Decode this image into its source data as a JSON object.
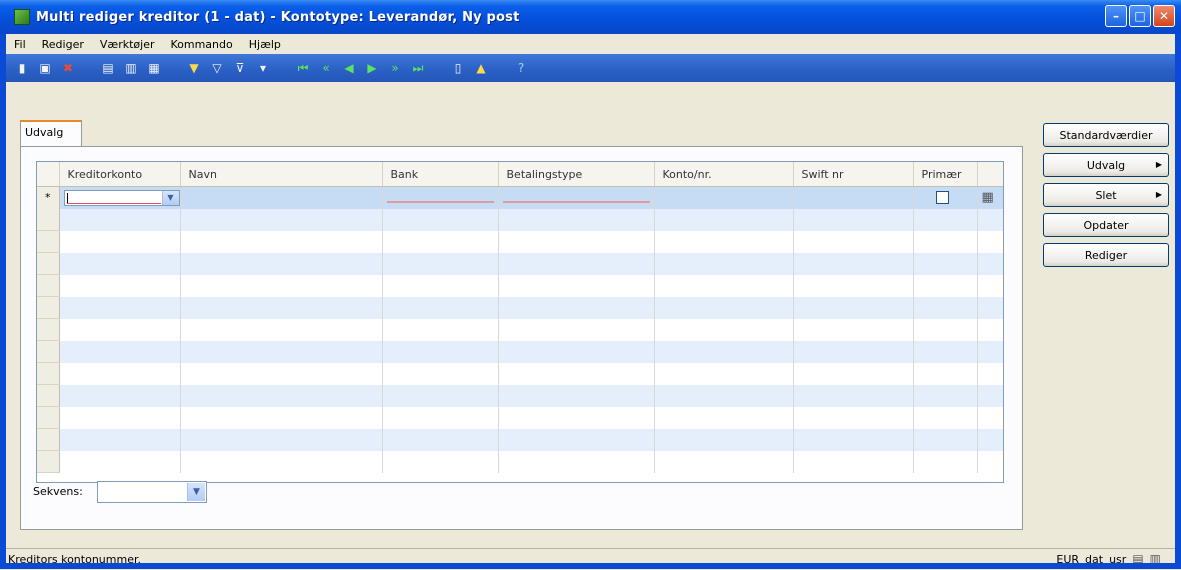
{
  "window": {
    "title": "Multi rediger kreditor (1 - dat) - Kontotype: Leverandør, Ny post"
  },
  "menu": [
    "Fil",
    "Rediger",
    "Værktøjer",
    "Kommando",
    "Hjælp"
  ],
  "tab": {
    "label": "Udvalg"
  },
  "grid": {
    "columns": [
      "Kreditorkonto",
      "Navn",
      "Bank",
      "Betalingstype",
      "Konto/nr.",
      "Swift nr",
      "Primær",
      ""
    ],
    "new_row_marker": "*"
  },
  "sequence": {
    "label": "Sekvens:",
    "value": ""
  },
  "buttons": {
    "defaults": "Standardværdier",
    "selection": "Udvalg",
    "delete": "Slet",
    "update": "Opdater",
    "edit": "Rediger"
  },
  "status": {
    "message": "Kreditors kontonummer.",
    "currency": "EUR",
    "company": "dat",
    "user": "usr"
  },
  "colors": {
    "title_bar": "#0550dc",
    "toolbar": "#2a5fc4",
    "row_alt": "#e5effb",
    "active_row": "#c6dcf5"
  }
}
